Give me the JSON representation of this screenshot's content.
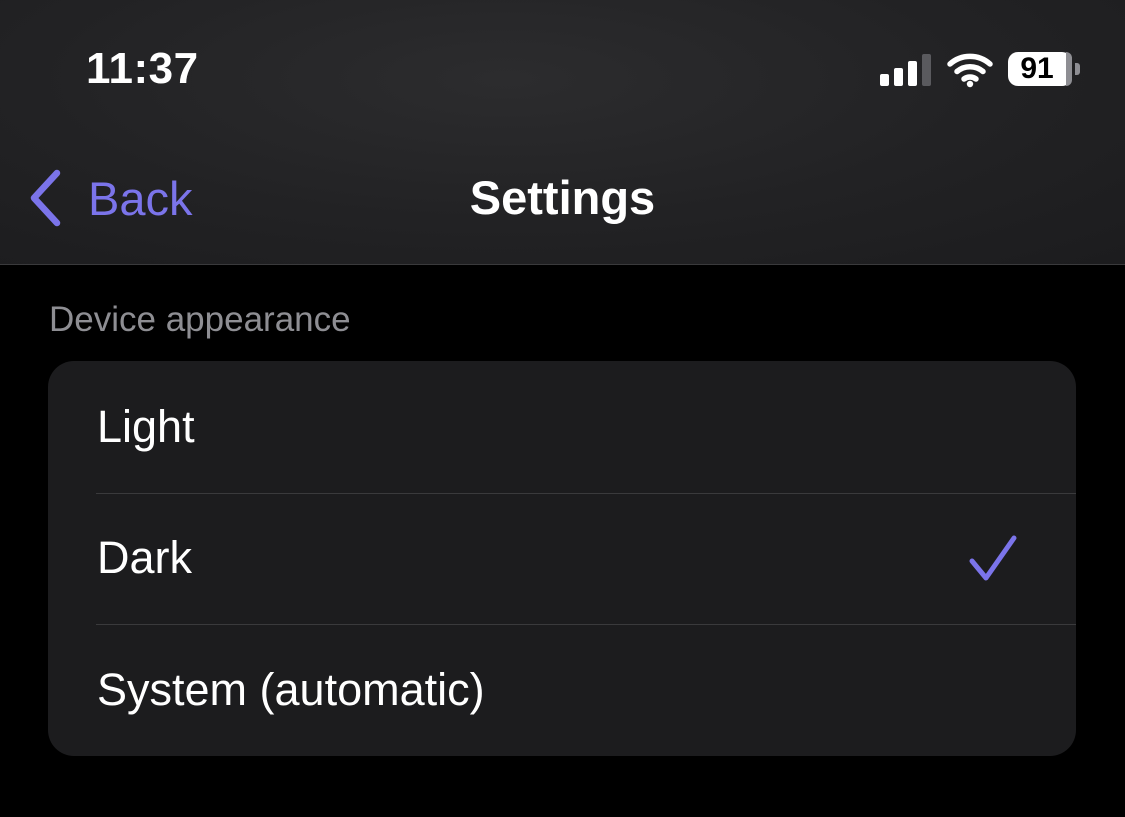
{
  "status_bar": {
    "time": "11:37",
    "battery_percent": 91,
    "battery_label": "91",
    "signal_bars_active": 3,
    "signal_bars_total": 4,
    "icons": [
      "cellular-signal-icon",
      "wifi-icon",
      "battery-icon"
    ]
  },
  "nav": {
    "back_label": "Back",
    "title": "Settings"
  },
  "appearance": {
    "section_header": "Device appearance",
    "options": [
      {
        "label": "Light",
        "selected": false
      },
      {
        "label": "Dark",
        "selected": true
      },
      {
        "label": "System (automatic)",
        "selected": false
      }
    ]
  },
  "colors": {
    "accent": "#7b74ea",
    "background": "#000000",
    "card": "#1c1c1e",
    "separator": "#3a3a3c",
    "secondary_text": "#8e8e93"
  }
}
